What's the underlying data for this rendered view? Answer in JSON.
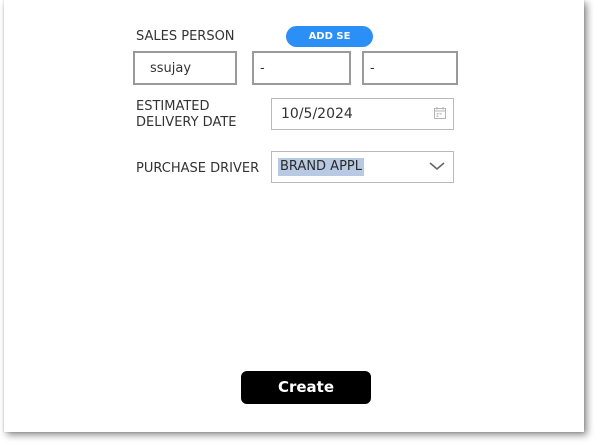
{
  "form": {
    "sales_person": {
      "label": "SALES PERSON",
      "add_button_label": "ADD SE",
      "fields": [
        "ssujay",
        "-",
        "-"
      ]
    },
    "delivery_date": {
      "label": "ESTIMATED\nDELIVERY DATE",
      "value": "10/5/2024",
      "icon": "calendar-icon"
    },
    "purchase_driver": {
      "label": "PURCHASE DRIVER",
      "selected": "BRAND APPL",
      "icon": "chevron-down-icon"
    },
    "create_label": "Create"
  },
  "colors": {
    "accent": "#2c8ff5",
    "selection_highlight": "#b8c9e4",
    "primary_button": "#000000"
  }
}
